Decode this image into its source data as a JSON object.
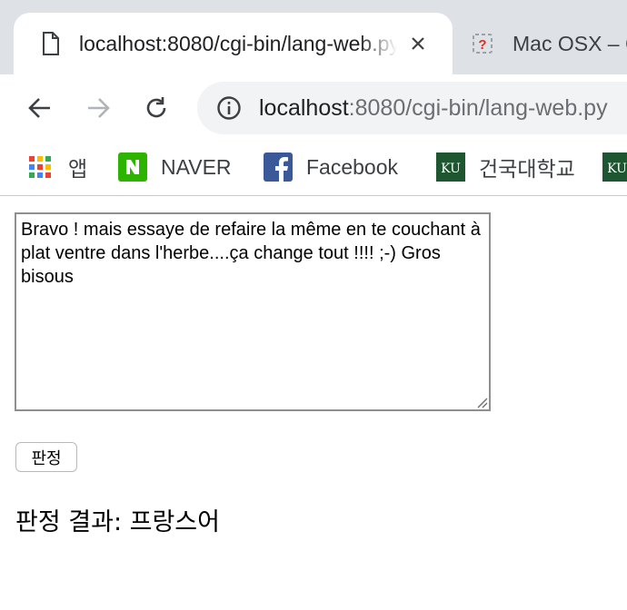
{
  "tabs": [
    {
      "title": "localhost:8080/cgi-bin/lang-web.py",
      "icon": "document-icon",
      "active": true
    },
    {
      "title": "Mac OSX – Cyb",
      "icon": "puzzle-error-icon",
      "active": false
    }
  ],
  "toolbar": {
    "url_host": "localhost",
    "url_rest": ":8080/cgi-bin/lang-web.py"
  },
  "bookmarks": [
    {
      "label": "앱",
      "icon": "apps-grid-icon"
    },
    {
      "label": "NAVER",
      "icon": "naver-icon"
    },
    {
      "label": "Facebook",
      "icon": "facebook-icon"
    },
    {
      "label": "건국대학교",
      "icon": "ku-icon"
    }
  ],
  "form": {
    "text": "Bravo ! mais essaye de refaire la même en te couchant à plat ventre dans l'herbe....ça change tout !!!! ;-) Gros bisous",
    "submit_label": "판정",
    "result_text": "판정 결과: 프랑스어"
  },
  "colors": {
    "tabstrip": "#dee1e6",
    "omnibox": "#f1f3f4",
    "naver": "#2db400",
    "facebook": "#3b5998",
    "ku": "#1e5631"
  }
}
